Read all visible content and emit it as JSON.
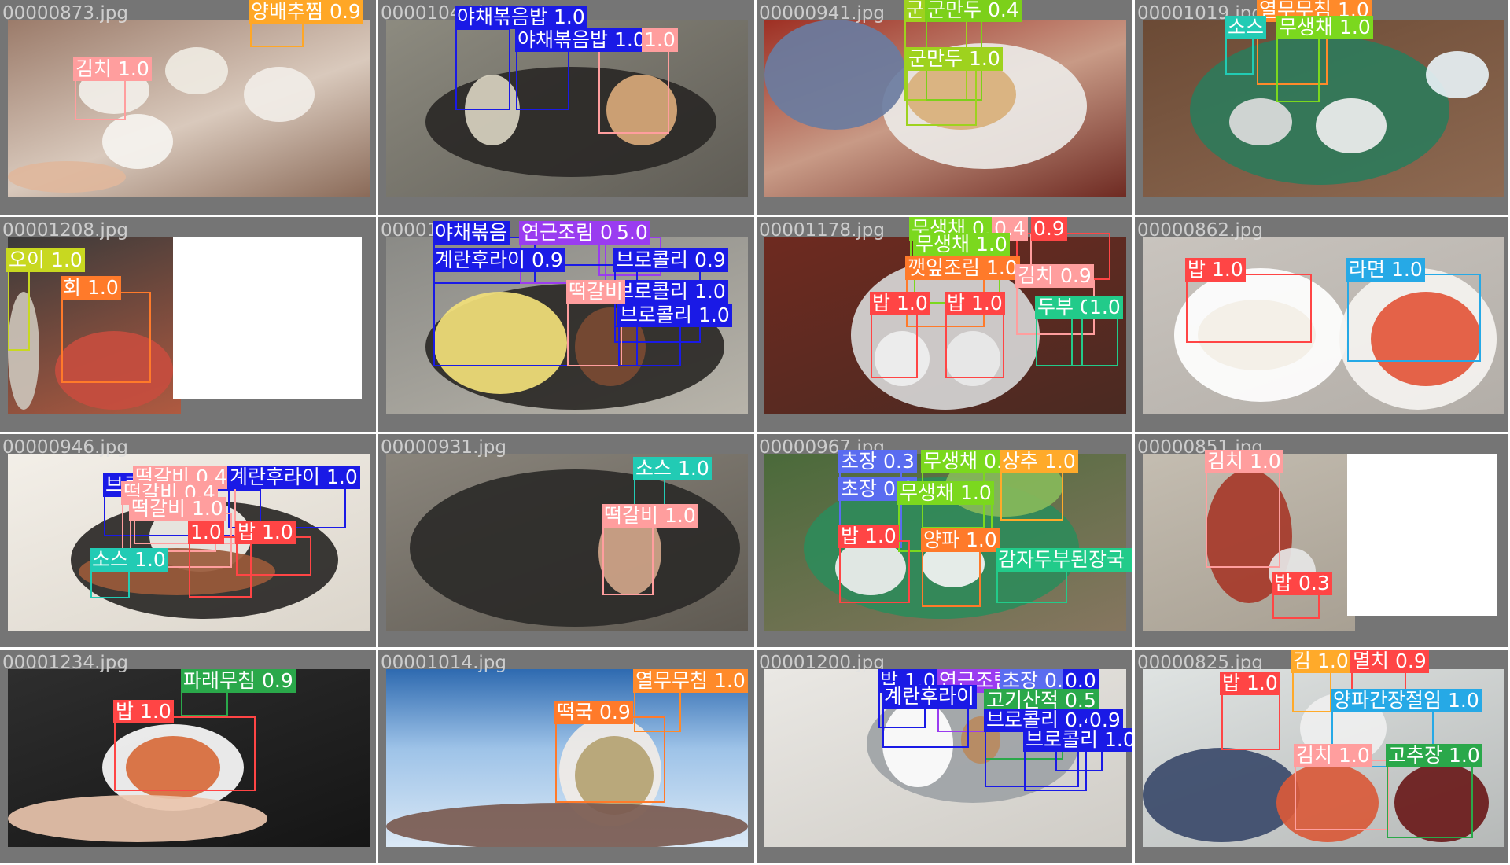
{
  "colors": {
    "cell_bg": "#757575",
    "label_text": "#ffffff",
    "filename_text": "#e1e1e1"
  },
  "cells": [
    {
      "filename": "00000873.jpg",
      "detections": [
        {
          "label": "양배추찜",
          "score": "0.9",
          "color": "#ffa726"
        },
        {
          "label": "김치",
          "score": "1.0",
          "color": "#ff9e9e"
        }
      ]
    },
    {
      "filename": "00001041.jpg",
      "detections": [
        {
          "label": "야채볶음밥",
          "score": "1.0",
          "color": "#1a1ae6"
        },
        {
          "label": "야채볶음밥",
          "score": "1.0",
          "color": "#1a1ae6"
        },
        {
          "label": "",
          "score": "1.0",
          "color": "#ff9e9e"
        }
      ]
    },
    {
      "filename": "00000941.jpg",
      "detections": [
        {
          "label": "군만두",
          "score": "1.0",
          "color": "#9ed21e"
        },
        {
          "label": "군만두",
          "score": "0.4",
          "color": "#7cd01a"
        },
        {
          "label": "군만두",
          "score": "1.0",
          "color": "#9ed21e"
        }
      ]
    },
    {
      "filename": "00001019.jpg",
      "detections": [
        {
          "label": "열무무침",
          "score": "1.0",
          "color": "#ff8a2a"
        },
        {
          "label": "소스",
          "score": "",
          "color": "#22cbb4"
        },
        {
          "label": "무생채",
          "score": "1.0",
          "color": "#7bd81e"
        }
      ]
    },
    {
      "filename": "00001208.jpg",
      "detections": [
        {
          "label": "오이",
          "score": "1.0",
          "color": "#c8d820"
        },
        {
          "label": "회",
          "score": "1.0",
          "color": "#ff7a2a"
        }
      ]
    },
    {
      "filename": "00001180.jpg",
      "detections": [
        {
          "label": "야채볶음",
          "score": "",
          "color": "#1a1ae6"
        },
        {
          "label": "연근조림",
          "score": "0.4",
          "color": "#9a3cf0"
        },
        {
          "label": "",
          "score": "5.0",
          "color": "#9a3cf0"
        },
        {
          "label": "계란후라이",
          "score": "0.9",
          "color": "#1a1ae6"
        },
        {
          "label": "브로콜리",
          "score": "0.9",
          "color": "#1a1ae6"
        },
        {
          "label": "브로콜리",
          "score": "1.0",
          "color": "#1a1ae6"
        },
        {
          "label": "떡갈비",
          "score": "",
          "color": "#ff9e9e"
        },
        {
          "label": "브로콜리",
          "score": "1.0",
          "color": "#1a1ae6"
        }
      ]
    },
    {
      "filename": "00001178.jpg",
      "detections": [
        {
          "label": "무생채",
          "score": "0.3",
          "color": "#7bd81e"
        },
        {
          "label": "",
          "score": "0.4",
          "color": "#ff9e9e"
        },
        {
          "label": "",
          "score": "0.9",
          "color": "#ff4545"
        },
        {
          "label": "무생채",
          "score": "1.0",
          "color": "#7bd81e"
        },
        {
          "label": "깻잎조림",
          "score": "1.0",
          "color": "#ff7a2a"
        },
        {
          "label": "김치",
          "score": "0.9",
          "color": "#ff9e9e"
        },
        {
          "label": "밥",
          "score": "1.0",
          "color": "#ff4545"
        },
        {
          "label": "밥",
          "score": "1.0",
          "color": "#ff4545"
        },
        {
          "label": "두부",
          "score": "0.4",
          "color": "#22cb8a"
        },
        {
          "label": "",
          "score": "1.0",
          "color": "#22cb8a"
        }
      ]
    },
    {
      "filename": "00000862.jpg",
      "detections": [
        {
          "label": "밥",
          "score": "1.0",
          "color": "#ff4545"
        },
        {
          "label": "라면",
          "score": "1.0",
          "color": "#26a9e6"
        }
      ]
    },
    {
      "filename": "00000946.jpg",
      "detections": [
        {
          "label": "브로",
          "score": "",
          "color": "#1a1ae6"
        },
        {
          "label": "떡갈비",
          "score": "0.4",
          "color": "#ff9e9e"
        },
        {
          "label": "계란후라이",
          "score": "1.0",
          "color": "#1a1ae6"
        },
        {
          "label": "떡갈비",
          "score": "0.4",
          "color": "#ff9e9e"
        },
        {
          "label": "떡갈비",
          "score": "1.0",
          "color": "#ff9e9e"
        },
        {
          "label": "밥",
          "score": "1.0",
          "color": "#ff4545"
        },
        {
          "label": "소스",
          "score": "1.0",
          "color": "#22cbb4"
        },
        {
          "label": "",
          "score": "1.0",
          "color": "#ff4545"
        }
      ]
    },
    {
      "filename": "00000931.jpg",
      "detections": [
        {
          "label": "소스",
          "score": "1.0",
          "color": "#22cbb4"
        },
        {
          "label": "떡갈비",
          "score": "1.0",
          "color": "#ff9e9e"
        }
      ]
    },
    {
      "filename": "00000967.jpg",
      "detections": [
        {
          "label": "초장",
          "score": "0.3",
          "color": "#5a6cf0"
        },
        {
          "label": "무생채",
          "score": "0.4",
          "color": "#7bd81e"
        },
        {
          "label": "상추",
          "score": "1.0",
          "color": "#ffaa2a"
        },
        {
          "label": "초장",
          "score": "0.9",
          "color": "#5a6cf0"
        },
        {
          "label": "무생채",
          "score": "1.0",
          "color": "#7bd81e"
        },
        {
          "label": "밥",
          "score": "1.0",
          "color": "#ff4545"
        },
        {
          "label": "양파",
          "score": "1.0",
          "color": "#ff7a2a"
        },
        {
          "label": "감자두부된장국",
          "score": "1.0",
          "color": "#22cb8a"
        }
      ]
    },
    {
      "filename": "00000851.jpg",
      "detections": [
        {
          "label": "김치",
          "score": "1.0",
          "color": "#ff9e9e"
        },
        {
          "label": "밥",
          "score": "0.3",
          "color": "#ff4545"
        }
      ]
    },
    {
      "filename": "00001234.jpg",
      "detections": [
        {
          "label": "파래무침",
          "score": "0.9",
          "color": "#2aa84a"
        },
        {
          "label": "밥",
          "score": "1.0",
          "color": "#ff4545"
        }
      ]
    },
    {
      "filename": "00001014.jpg",
      "detections": [
        {
          "label": "열무무침",
          "score": "1.0",
          "color": "#ff8a2a"
        },
        {
          "label": "떡국",
          "score": "0.9",
          "color": "#ff7a2a"
        }
      ]
    },
    {
      "filename": "00001200.jpg",
      "detections": [
        {
          "label": "밥",
          "score": "1.0",
          "color": "#1a1ae6"
        },
        {
          "label": "연근조림",
          "score": "",
          "color": "#9a3cf0"
        },
        {
          "label": "초장",
          "score": "0.9",
          "color": "#5a6cf0"
        },
        {
          "label": "",
          "score": "0.0",
          "color": "#1a1ae6"
        },
        {
          "label": "계란후라이",
          "score": "",
          "color": "#1a1ae6"
        },
        {
          "label": "고기산적",
          "score": "0.5",
          "color": "#2aa84a"
        },
        {
          "label": "브로콜리",
          "score": "0.4",
          "color": "#1a1ae6"
        },
        {
          "label": "",
          "score": "0.9",
          "color": "#1a1ae6"
        },
        {
          "label": "브로콜리",
          "score": "1.0",
          "color": "#1a1ae6"
        }
      ]
    },
    {
      "filename": "00000825.jpg",
      "detections": [
        {
          "label": "김",
          "score": "1.0",
          "color": "#ffaa2a"
        },
        {
          "label": "멸치",
          "score": "0.9",
          "color": "#ff4545"
        },
        {
          "label": "밥",
          "score": "1.0",
          "color": "#ff4545"
        },
        {
          "label": "양파간장절임",
          "score": "1.0",
          "color": "#26a9e6"
        },
        {
          "label": "김치",
          "score": "1.0",
          "color": "#ff9e9e"
        },
        {
          "label": "고추장",
          "score": "1.0",
          "color": "#2aa84a"
        }
      ]
    }
  ]
}
